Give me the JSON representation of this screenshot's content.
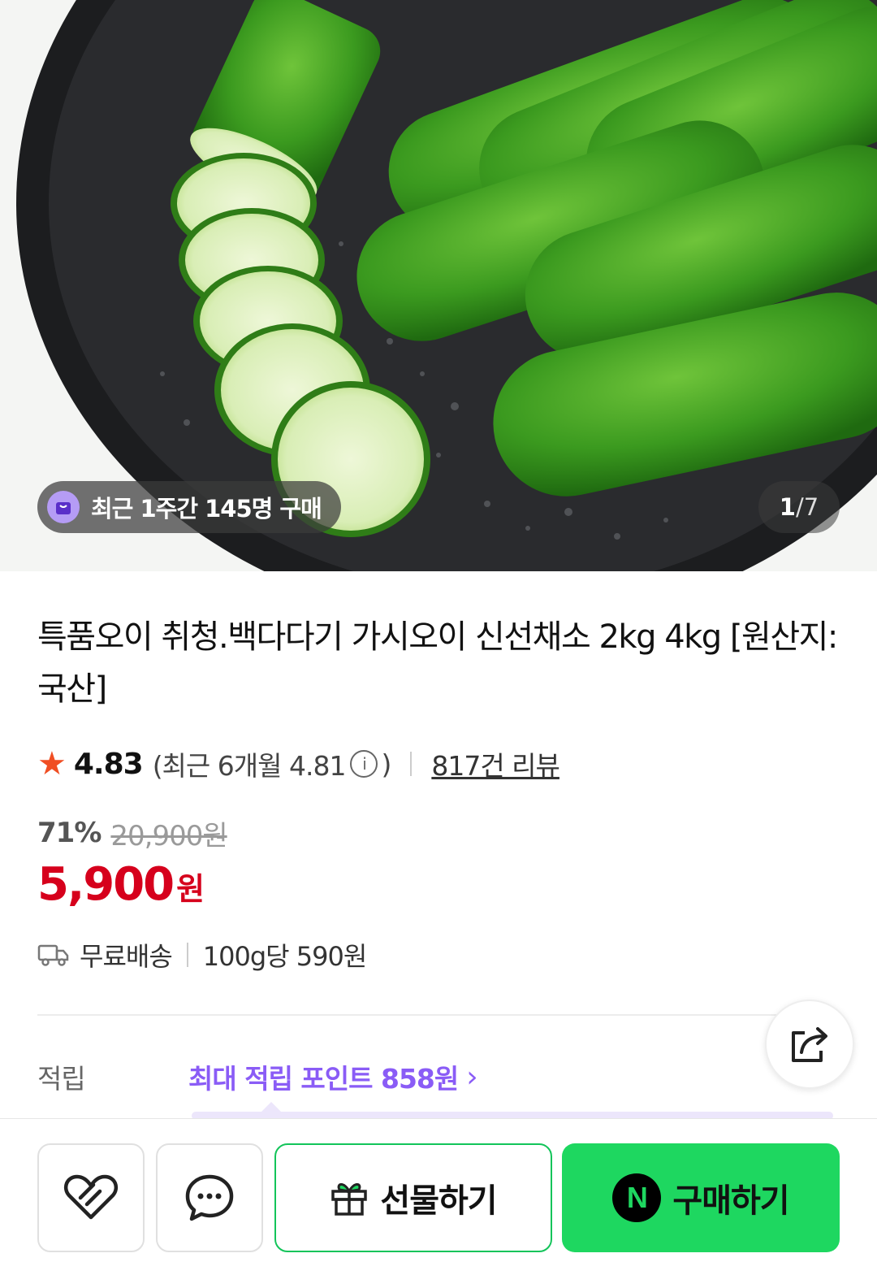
{
  "hero": {
    "recent_badge": "최근 1주간 145명 구매",
    "pager_current": "1",
    "pager_separator": "/",
    "pager_total": "7"
  },
  "product": {
    "title": "특품오이 취청.백다다기 가시오이 신선채소 2kg 4kg [원산지:국산]",
    "rating": "4.83",
    "recent_rating_prefix": "(최근 6개월 4.81",
    "recent_rating_suffix": ")",
    "review_count": "817건 리뷰",
    "discount_rate": "71%",
    "original_price": "20,900원",
    "price": "5,900",
    "price_unit": "원",
    "shipping": "무료배송",
    "unit_price": "100g당 590원"
  },
  "points": {
    "label": "적립",
    "value": "최대 적립 포인트 858원"
  },
  "actions": {
    "gift_label": "선물하기",
    "buy_label": "구매하기",
    "npay_letter": "N"
  },
  "icons": {
    "bag": "shopping-bag-icon",
    "info": "info-icon",
    "truck": "truck-icon",
    "share": "share-icon",
    "heart": "heart-icon",
    "chat": "chat-icon",
    "gift": "gift-icon"
  },
  "colors": {
    "price_red": "#d6001c",
    "points_purple": "#8a5cf6",
    "buy_green": "#1ed760",
    "star_orange": "#f04e23"
  }
}
